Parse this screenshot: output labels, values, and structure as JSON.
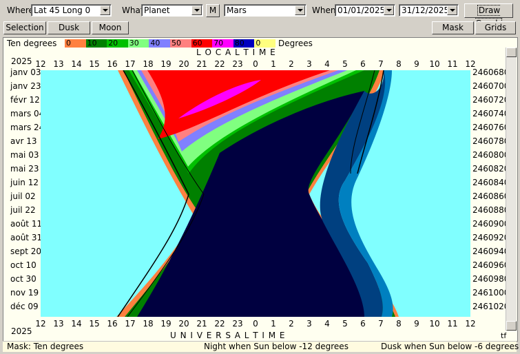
{
  "toolbar": {
    "where_label": "Where",
    "where_value": "Lat 45 Long 0",
    "what_label": "What",
    "what_value": "Planet",
    "m_button": "M",
    "object_value": "Mars",
    "when_label": "When",
    "date_from": "01/01/2025",
    "date_to": "31/12/2025",
    "draw_button": "Draw Graph"
  },
  "buttons": {
    "selection": "Selection",
    "dusk": "Dusk",
    "moon": "Moon",
    "mask": "Mask",
    "grids": "Grids"
  },
  "legend": {
    "title": "Ten degrees",
    "unit": "Degrees",
    "items": [
      {
        "label": "0",
        "color": "#ff8040"
      },
      {
        "label": "10",
        "color": "#008000"
      },
      {
        "label": "20",
        "color": "#00c000"
      },
      {
        "label": "30",
        "color": "#80ff80"
      },
      {
        "label": "40",
        "color": "#8080ff"
      },
      {
        "label": "50",
        "color": "#ff8080"
      },
      {
        "label": "60",
        "color": "#ff0000"
      },
      {
        "label": "70",
        "color": "#ff00ff"
      },
      {
        "label": "80",
        "color": "#0000c0"
      },
      {
        "label": "0",
        "color": "#ffff80"
      }
    ]
  },
  "chart": {
    "top_title": "L O C A L     T I M E",
    "bottom_title": "U N I V E R S A L     T I M E",
    "year_top": "2025",
    "year_bottom": "2025",
    "corner": "tf",
    "hour_ticks": [
      "12",
      "13",
      "14",
      "15",
      "16",
      "17",
      "18",
      "19",
      "20",
      "21",
      "22",
      "23",
      "0",
      "1",
      "2",
      "3",
      "4",
      "5",
      "6",
      "7",
      "8",
      "9",
      "10",
      "11",
      "12"
    ],
    "date_labels": [
      "janv 03",
      "janv 23",
      "févr 12",
      "mars 04",
      "mars 24",
      "avr 13",
      "mai 03",
      "mai 23",
      "juin 12",
      "juil 02",
      "juil 22",
      "août 11",
      "août 31",
      "sept 20",
      "oct 10",
      "oct 30",
      "nov 19",
      "déc 09"
    ],
    "jd_labels": [
      "2460680",
      "2460700",
      "2460720",
      "2460740",
      "2460760",
      "2460780",
      "2460800",
      "2460820",
      "2460840",
      "2460860",
      "2460880",
      "2460900",
      "2460920",
      "2460940",
      "2460960",
      "2460980",
      "2461000",
      "2461020"
    ],
    "colors": {
      "day": "#80ffff",
      "night": "#000040",
      "twilight1": "#0080c0",
      "twilight2": "#004080"
    }
  },
  "status": {
    "mask": "Mask:  Ten degrees",
    "night": "Night when Sun below -12 degrees",
    "dusk": "Dusk when Sun below -6 degrees"
  }
}
